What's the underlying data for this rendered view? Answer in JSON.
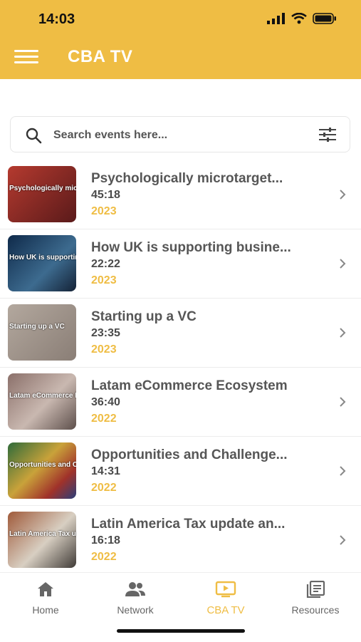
{
  "status_bar": {
    "time": "14:03"
  },
  "header": {
    "title": "CBA TV"
  },
  "search": {
    "placeholder": "Search events here..."
  },
  "events": [
    {
      "title": "Psychologically microtarget...",
      "duration": "45:18",
      "year": "2023",
      "thumb_text": "Psychologically microtargeted marketing",
      "thumb_color": "#8a2b2b"
    },
    {
      "title": "How UK is supporting busine...",
      "duration": "22:22",
      "year": "2023",
      "thumb_text": "How UK is supporting business in LatAm",
      "thumb_color": "#1d3552"
    },
    {
      "title": "Starting up a VC",
      "duration": "23:35",
      "year": "2023",
      "thumb_text": "Starting up a VC",
      "thumb_color": "#9b8e84"
    },
    {
      "title": "Latam eCommerce Ecosystem",
      "duration": "36:40",
      "year": "2022",
      "thumb_text": "Latam eCommerce Ecosystem",
      "thumb_color": "#7b6a66"
    },
    {
      "title": "Opportunities and Challenge...",
      "duration": "14:31",
      "year": "2022",
      "thumb_text": "Opportunities and Challenges in Latin America",
      "thumb_color": "#3f5b3a"
    },
    {
      "title": "Latin America Tax update an...",
      "duration": "16:18",
      "year": "2022",
      "thumb_text": "Latin America Tax update and outlook",
      "thumb_color": "#6c5a48"
    }
  ],
  "nav": {
    "home": "Home",
    "network": "Network",
    "cba_tv": "CBA TV",
    "resources": "Resources"
  },
  "colors": {
    "accent": "#efbd44"
  }
}
